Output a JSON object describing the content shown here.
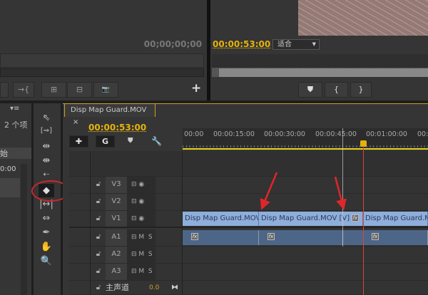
{
  "source_monitor": {
    "timecode": "00;00;00;00",
    "buttons": [
      "→{",
      "⊞",
      "⊟",
      "📷"
    ],
    "add": "+"
  },
  "program_monitor": {
    "timecode": "00:00:53:00",
    "fit_label": "适合",
    "buttons": [
      "marker",
      "{",
      "}"
    ]
  },
  "project_panel": {
    "item_count": "2 个项",
    "column_header": "始",
    "row_value": "0:00"
  },
  "tools": [
    "selection",
    "track-select",
    "ripple-edit",
    "rolling-edit",
    "rate-stretch",
    "razor",
    "slip",
    "slide",
    "pen",
    "hand",
    "zoom"
  ],
  "timeline": {
    "tab_label": "Disp Map Guard.MOV",
    "close": "×",
    "timecode": "00:00:53:00",
    "ruler": [
      "00:00",
      "00:00:15:00",
      "00:00:30:00",
      "00:00:45:00",
      "00:01:00:00",
      "00:"
    ],
    "video_tracks": [
      {
        "name": "V3"
      },
      {
        "name": "V2"
      },
      {
        "name": "V1"
      }
    ],
    "audio_tracks": [
      {
        "name": "A1",
        "m": "M",
        "s": "S"
      },
      {
        "name": "A2",
        "m": "M",
        "s": "S"
      },
      {
        "name": "A3",
        "m": "M",
        "s": "S"
      }
    ],
    "master": {
      "name": "主声道",
      "value": "0.0"
    },
    "clips": [
      "Disp Map Guard.MOV",
      "Disp Map Guard.MOV [V]",
      "Disp Map Guard.MOV"
    ],
    "fx": "fx"
  },
  "colors": {
    "accent": "#e5b20c",
    "playhead": "#d9443a",
    "video_clip": "#8eaedb",
    "audio_clip": "#4d6688"
  }
}
